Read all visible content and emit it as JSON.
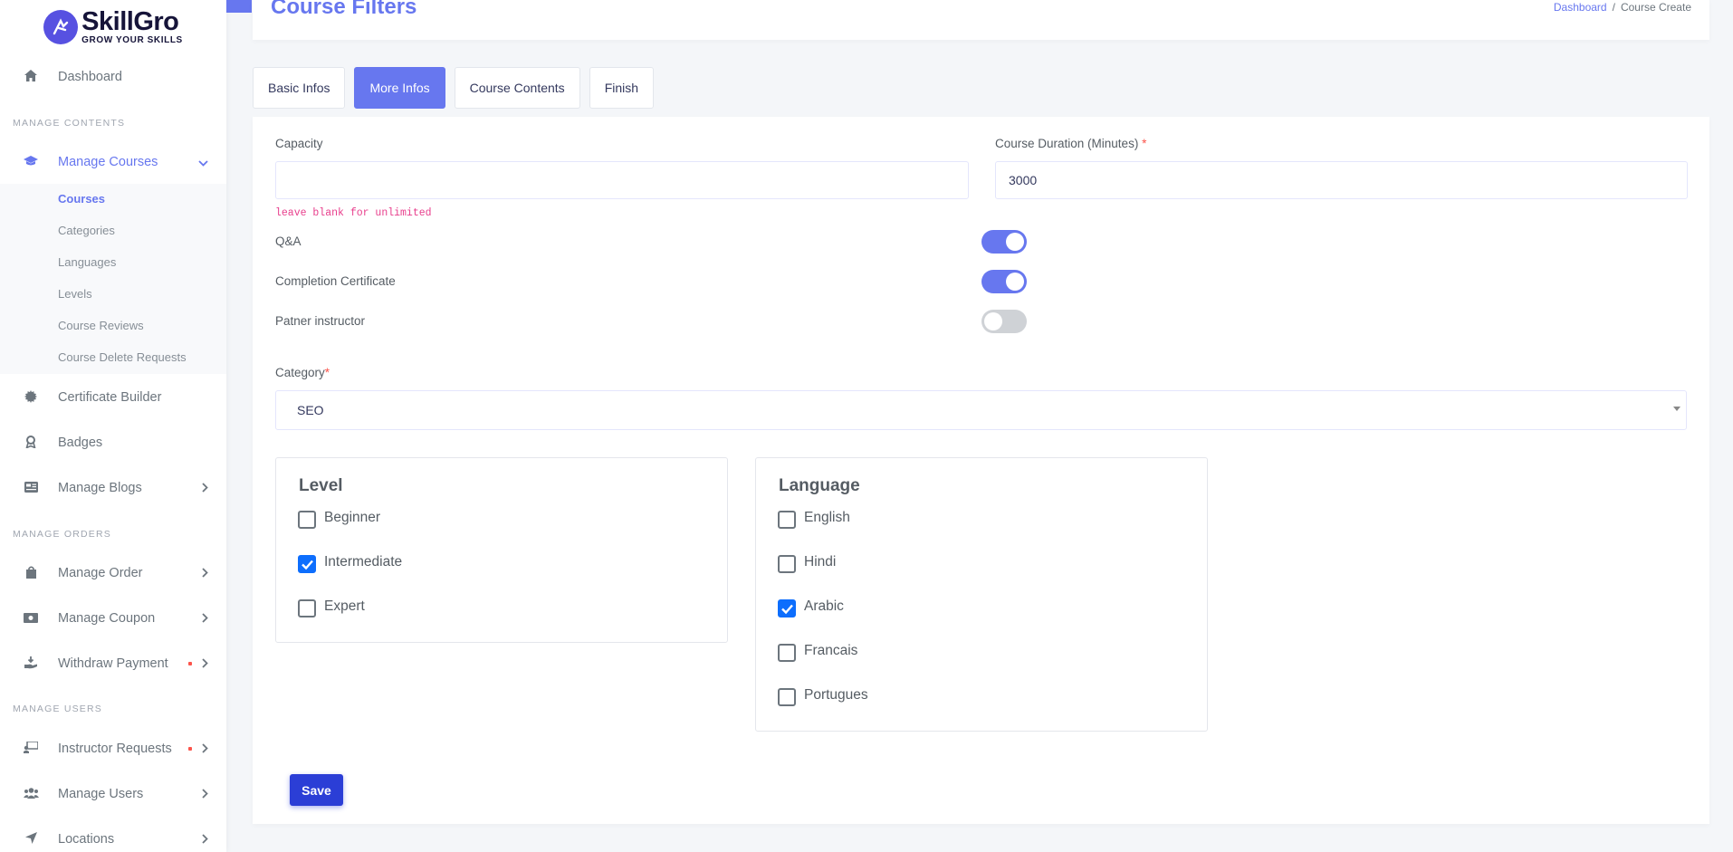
{
  "brand": {
    "name": "SkillGro",
    "tagline": "GROW YOUR SKILLS"
  },
  "sidebar": {
    "dashboard": "Dashboard",
    "headers": {
      "contents": "MANAGE CONTENTS",
      "orders": "MANAGE ORDERS",
      "users": "MANAGE USERS"
    },
    "manage_courses": "Manage Courses",
    "courses_sub": [
      "Courses",
      "Categories",
      "Languages",
      "Levels",
      "Course Reviews",
      "Course Delete Requests"
    ],
    "certificate_builder": "Certificate Builder",
    "badges": "Badges",
    "manage_blogs": "Manage Blogs",
    "manage_order": "Manage Order",
    "manage_coupon": "Manage Coupon",
    "withdraw_payment": "Withdraw Payment",
    "instructor_requests": "Instructor Requests",
    "manage_users": "Manage Users",
    "locations": "Locations"
  },
  "header": {
    "title": "Course Filters",
    "breadcrumb": {
      "home": "Dashboard",
      "separator": "/",
      "current": "Course Create"
    }
  },
  "tabs": [
    "Basic Infos",
    "More Infos",
    "Course Contents",
    "Finish"
  ],
  "form": {
    "capacity_label": "Capacity",
    "capacity_value": "",
    "capacity_hint": "leave blank for unlimited",
    "duration_label": "Course Duration (Minutes)",
    "duration_required": "*",
    "duration_value": "3000",
    "toggles": [
      {
        "label": "Q&A",
        "on": true
      },
      {
        "label": "Completion Certificate",
        "on": true
      },
      {
        "label": "Patner instructor",
        "on": false
      }
    ],
    "category_label": "Category",
    "category_required": "*",
    "category_value": "SEO",
    "level_title": "Level",
    "levels": [
      {
        "label": "Beginner",
        "checked": false
      },
      {
        "label": "Intermediate",
        "checked": true
      },
      {
        "label": "Expert",
        "checked": false
      }
    ],
    "language_title": "Language",
    "languages": [
      {
        "label": "English",
        "checked": false
      },
      {
        "label": "Hindi",
        "checked": false
      },
      {
        "label": "Arabic",
        "checked": true
      },
      {
        "label": "Francais",
        "checked": false
      },
      {
        "label": "Portugues",
        "checked": false
      }
    ],
    "save_label": "Save"
  },
  "colors": {
    "accent": "#6777ef",
    "save": "#2b3ed6",
    "checkbox": "#0d6efd",
    "required": "#fc544b"
  }
}
